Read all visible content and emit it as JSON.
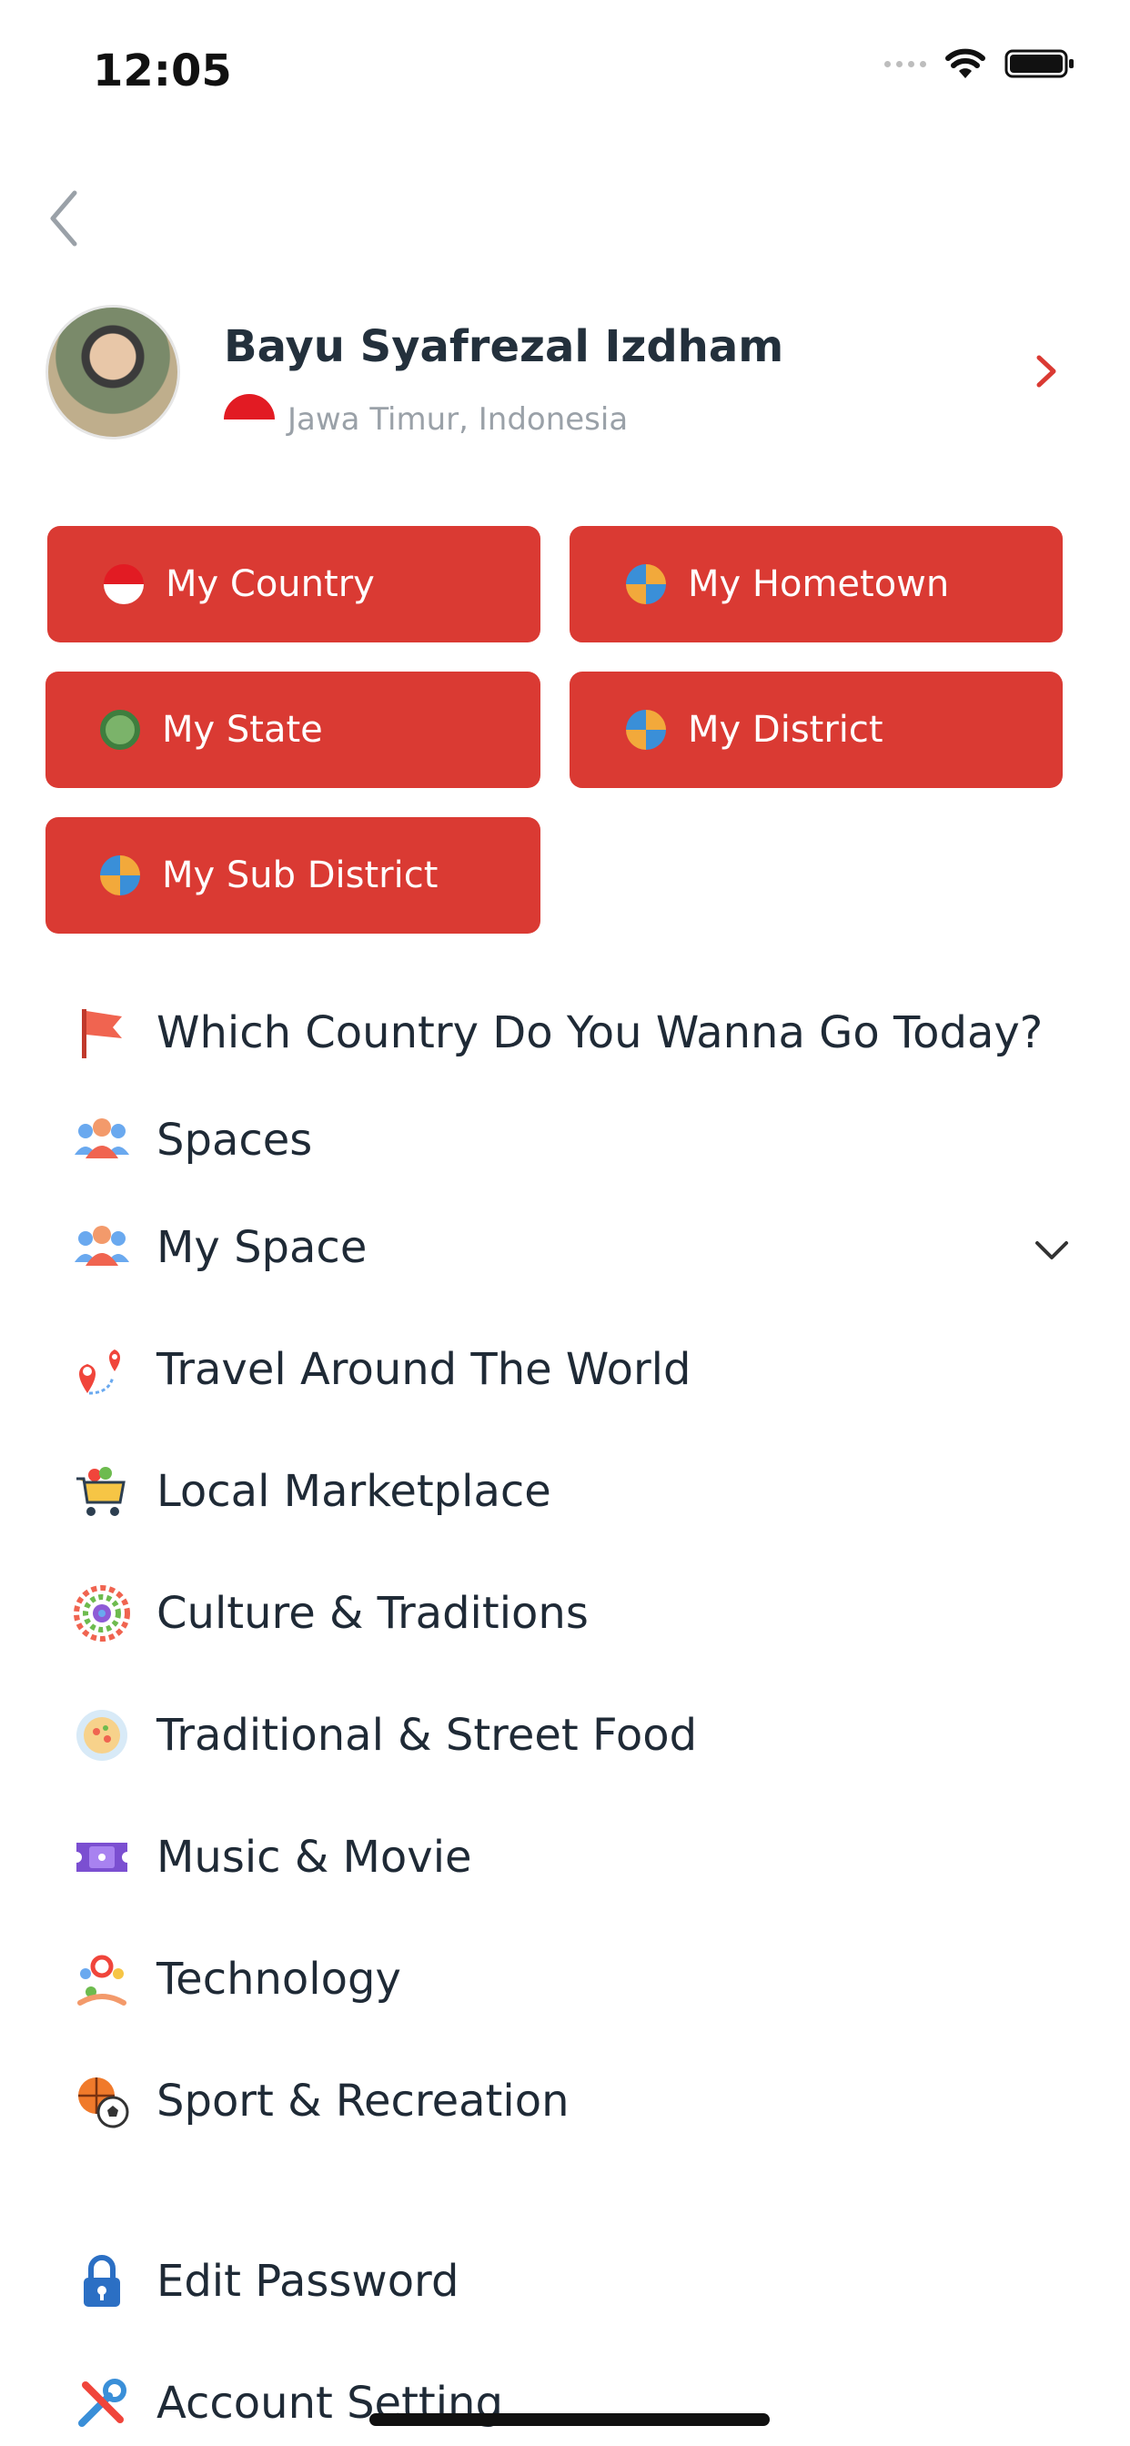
{
  "status_bar": {
    "time": "12:05"
  },
  "profile": {
    "name": "Bayu Syafrezal Izdham",
    "location": "Jawa Timur, Indonesia"
  },
  "quick_buttons": [
    {
      "label": "My Country",
      "icon": "indonesia-flag-icon"
    },
    {
      "label": "My Hometown",
      "icon": "globe-icon"
    },
    {
      "label": "My State",
      "icon": "state-emblem-icon"
    },
    {
      "label": "My District",
      "icon": "globe-icon"
    },
    {
      "label": "My Sub District",
      "icon": "globe-icon"
    }
  ],
  "menu": [
    {
      "label": "Which Country Do You Wanna Go Today?",
      "icon": "flag-icon"
    },
    {
      "label": "Spaces",
      "icon": "people-icon"
    },
    {
      "label": "My Space",
      "icon": "people-icon",
      "expandable": true
    },
    {
      "label": "Travel Around The World",
      "icon": "map-pins-icon"
    },
    {
      "label": "Local Marketplace",
      "icon": "shopping-cart-icon"
    },
    {
      "label": "Culture & Traditions",
      "icon": "mandala-icon"
    },
    {
      "label": "Traditional & Street Food",
      "icon": "food-plate-icon"
    },
    {
      "label": "Music & Movie",
      "icon": "ticket-icon"
    },
    {
      "label": "Technology",
      "icon": "technology-icon"
    },
    {
      "label": "Sport & Recreation",
      "icon": "sports-balls-icon"
    },
    {
      "label": "Edit Password",
      "icon": "lock-icon"
    },
    {
      "label": "Account Setting",
      "icon": "tools-icon"
    }
  ],
  "colors": {
    "accent": "#da3a33",
    "text": "#1f2a36",
    "muted": "#9aa1a8"
  }
}
